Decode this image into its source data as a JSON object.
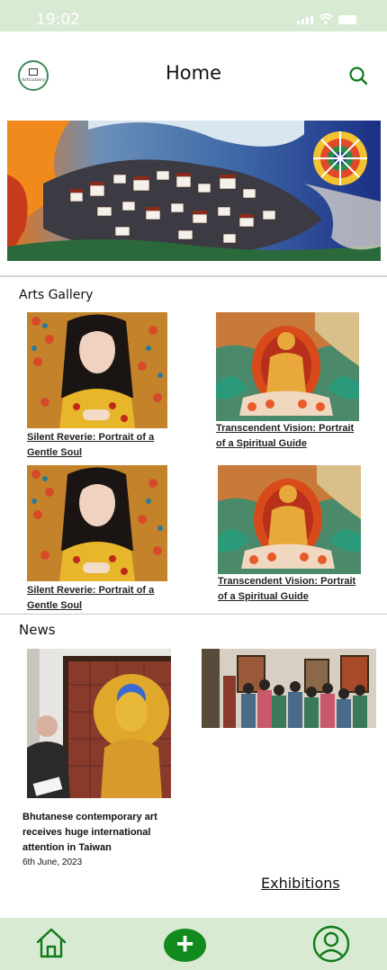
{
  "status_bar": {
    "time": "19:02",
    "icons": [
      "signal-icon",
      "wifi-icon",
      "battery-icon"
    ]
  },
  "header": {
    "title": "Home",
    "logo_text": "ArtGallery",
    "search_icon": "search-icon"
  },
  "hero": {
    "image": "landscape-painting-of-bhutanese-dzong-village"
  },
  "arts_gallery": {
    "title": "Arts Gallery",
    "items": [
      {
        "caption": "Silent Reverie: Portrait of a Gentle Soul",
        "image": "portrait-woman-painting"
      },
      {
        "caption": "Transcendent Vision: Portrait of a Spiritual Guide",
        "image": "thangka-deity-painting"
      },
      {
        "caption": "Silent Reverie: Portrait of a Gentle Soul",
        "image": "portrait-woman-painting"
      },
      {
        "caption": "Transcendent Vision: Portrait of a Spiritual Guide",
        "image": "thangka-deity-painting"
      }
    ]
  },
  "news": {
    "title": "News",
    "items": [
      {
        "headline": "Bhutanese contemporary art receives huge international attention in Taiwan",
        "date": "6th June, 2023",
        "image": "artist-with-buddha-painting"
      },
      {
        "image": "exhibition-crowd-photo"
      }
    ]
  },
  "exhibitions_link": "Exhibitions",
  "bottom_nav": {
    "items": [
      "home-icon",
      "add-icon",
      "profile-icon"
    ],
    "add_label": "+"
  },
  "colors": {
    "bar_green": "#d9ead3",
    "accent_green": "#118a1e",
    "icon_green": "#0f7a1a"
  }
}
